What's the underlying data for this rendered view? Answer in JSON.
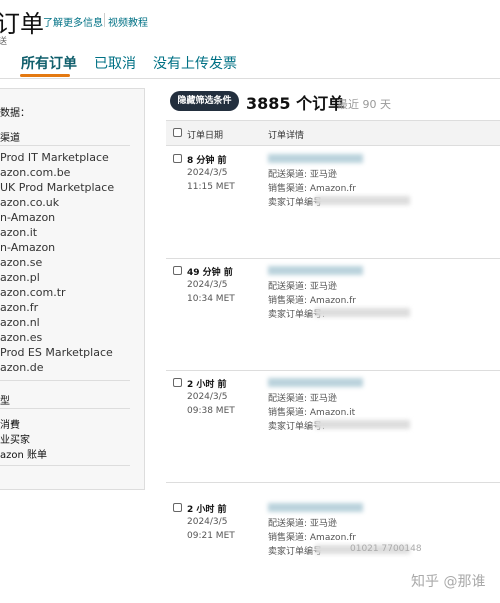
{
  "header": {
    "title": "订单",
    "learn_more": "了解更多信息",
    "video": "视频教程",
    "subtitle": "送"
  },
  "tabs": [
    {
      "label": "所有订单",
      "active": true
    },
    {
      "label": "已取消"
    },
    {
      "label": "没有上传发票"
    }
  ],
  "filters": {
    "data_label": "数据：",
    "channel_header": "渠道",
    "channels": [
      "Prod IT Marketplace",
      "azon.com.be",
      "UK Prod Marketplace",
      "azon.co.uk",
      "n-Amazon",
      "azon.it",
      "n-Amazon",
      "azon.se",
      "azon.pl",
      "azon.com.tr",
      "azon.fr",
      "azon.nl",
      "azon.es",
      "Prod ES Marketplace",
      "azon.de"
    ],
    "type_header": "型",
    "types": [
      "消費",
      "业买家",
      "azon 账单"
    ]
  },
  "toolbar": {
    "hide_filters": "隐藏筛选条件",
    "count": "3885 个订单",
    "range": "最近 90 天"
  },
  "table": {
    "col_date": "订单日期",
    "col_details": "订单详情",
    "rows": [
      {
        "relative": "8 分钟 前",
        "date": "2024/3/5",
        "time": "11:15 MET",
        "ship": "配送渠道: 亚马逊",
        "sales": "销售渠道: Amazon.fr",
        "seller": "卖家订单编号",
        "seller_visible": ""
      },
      {
        "relative": "49 分钟 前",
        "date": "2024/3/5",
        "time": "10:34 MET",
        "ship": "配送渠道: 亚马逊",
        "sales": "销售渠道: Amazon.fr",
        "seller": "卖家订单编号:",
        "seller_visible": ""
      },
      {
        "relative": "2 小时 前",
        "date": "2024/3/5",
        "time": "09:38 MET",
        "ship": "配送渠道: 亚马逊",
        "sales": "销售渠道: Amazon.it",
        "seller": "卖家订单编号:",
        "seller_visible": ""
      },
      {
        "relative": "2 小时 前",
        "date": "2024/3/5",
        "time": "09:21 MET",
        "ship": "配送渠道: 亚马逊",
        "sales": "销售渠道: Amazon.fr",
        "seller": "卖家订单编号",
        "seller_visible": "01021 7700148"
      }
    ]
  },
  "watermark": "知乎 @那谁",
  "colors": {
    "link": "#007185",
    "tab_underline": "#e47911",
    "button": "#232f3e"
  }
}
